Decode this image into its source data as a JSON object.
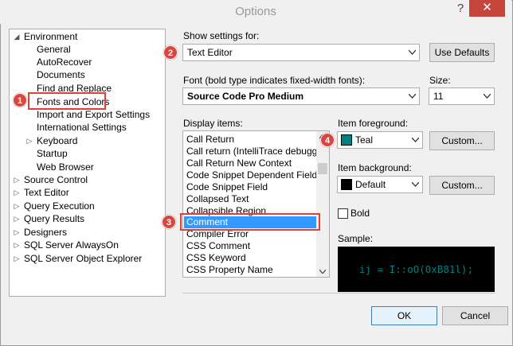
{
  "window": {
    "title": "Options",
    "help_glyph": "?",
    "close_glyph": "✕"
  },
  "tree": {
    "items": [
      {
        "label": "Environment",
        "expanded": true
      },
      {
        "label": "General"
      },
      {
        "label": "AutoRecover"
      },
      {
        "label": "Documents"
      },
      {
        "label": "Find and Replace"
      },
      {
        "label": "Fonts and Colors",
        "selected": true
      },
      {
        "label": "Import and Export Settings"
      },
      {
        "label": "International Settings"
      },
      {
        "label": "Keyboard"
      },
      {
        "label": "Startup"
      },
      {
        "label": "Web Browser"
      },
      {
        "label": "Source Control"
      },
      {
        "label": "Text Editor"
      },
      {
        "label": "Query Execution"
      },
      {
        "label": "Query Results"
      },
      {
        "label": "Designers"
      },
      {
        "label": "SQL Server AlwaysOn"
      },
      {
        "label": "SQL Server Object Explorer"
      }
    ]
  },
  "show_settings": {
    "label": "Show settings for:",
    "value": "Text Editor",
    "use_defaults": "Use Defaults"
  },
  "font": {
    "label": "Font (bold type indicates fixed-width fonts):",
    "value": "Source Code Pro Medium"
  },
  "size": {
    "label": "Size:",
    "value": "11"
  },
  "display_items": {
    "label": "Display items:",
    "items": [
      "Call Return",
      "Call return (IntelliTrace debugging",
      "Call Return New Context",
      "Code Snippet Dependent Field",
      "Code Snippet Field",
      "Collapsed Text",
      "Collapsible Region",
      "Comment",
      "Compiler Error",
      "CSS Comment",
      "CSS Keyword",
      "CSS Property Name"
    ],
    "selected": "Comment"
  },
  "foreground": {
    "label": "Item foreground:",
    "value": "Teal",
    "color": "#008080",
    "custom": "Custom..."
  },
  "background": {
    "label": "Item background:",
    "value": "Default",
    "color": "#000000",
    "custom": "Custom..."
  },
  "bold": {
    "label": "Bold",
    "checked": false
  },
  "sample": {
    "label": "Sample:",
    "text": "ij = I::oO(0xB81l);"
  },
  "buttons": {
    "ok": "OK",
    "cancel": "Cancel"
  },
  "callouts": {
    "c1": "1",
    "c2": "2",
    "c3": "3",
    "c4": "4"
  },
  "colors": {
    "accent": "#3399ff",
    "callout": "#d9453f",
    "close": "#c7463c"
  }
}
